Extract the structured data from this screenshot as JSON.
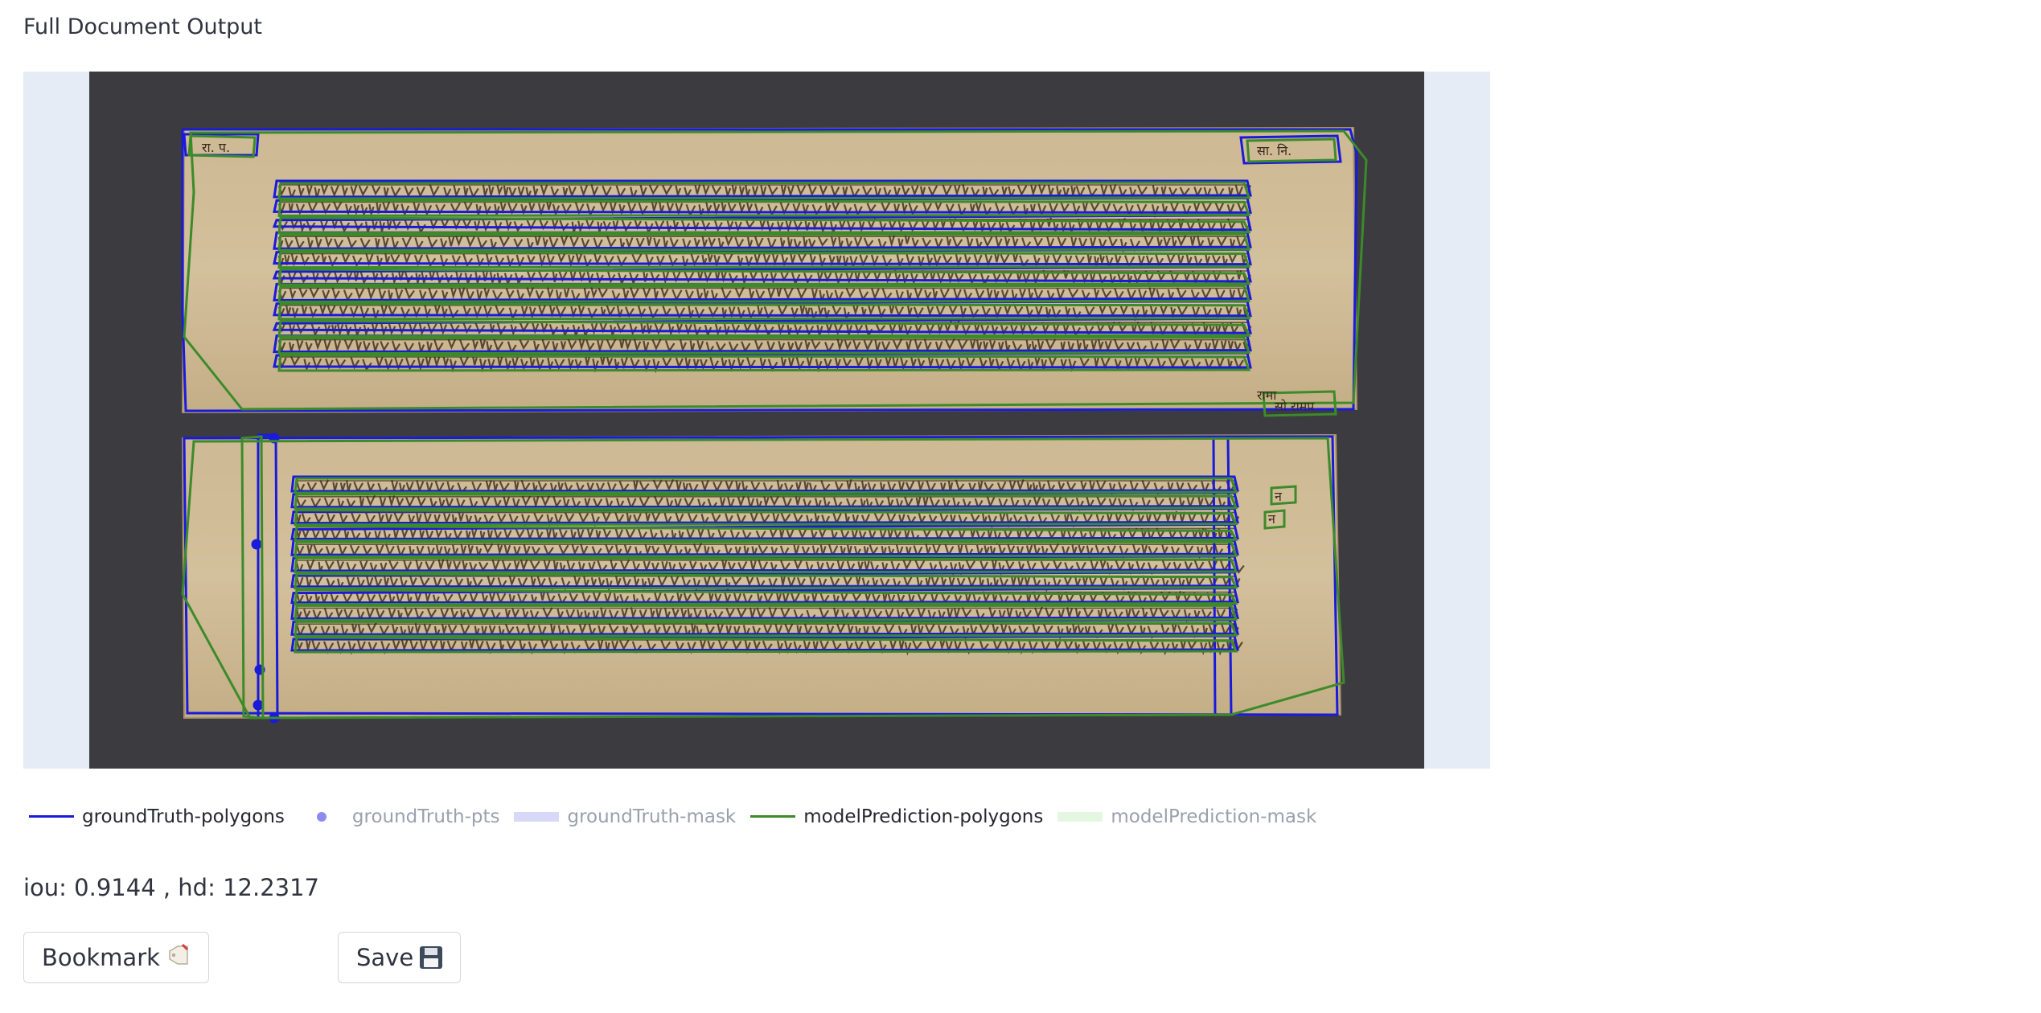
{
  "page": {
    "title": "Full Document Output"
  },
  "legend": [
    {
      "label": "groundTruth-polygons",
      "color": "#1a1adb",
      "kind": "line",
      "visible": true
    },
    {
      "label": "groundTruth-pts",
      "color": "#8c8cf0",
      "kind": "dot",
      "visible": false
    },
    {
      "label": "groundTruth-mask",
      "color": "#d8d8f8",
      "kind": "box",
      "visible": false
    },
    {
      "label": "modelPrediction-polygons",
      "color": "#3d8a2a",
      "kind": "line",
      "visible": true
    },
    {
      "label": "modelPrediction-mask",
      "color": "#e4f7e0",
      "kind": "box",
      "visible": false
    }
  ],
  "metrics": {
    "text": "iou: 0.9144 , hd: 12.2317"
  },
  "buttons": {
    "bookmark": {
      "label": "Bookmark",
      "icon": "bookmark-tag-icon"
    },
    "save": {
      "label": "Save",
      "icon": "floppy-disk-icon"
    }
  },
  "colors": {
    "plot_bg": "#e5ecf6",
    "image_bg": "#3c3b40",
    "palm_leaf": "#c8b48e",
    "ground_truth": "#1a1adb",
    "prediction": "#3d8a2a"
  },
  "document": {
    "margin_labels": [
      "रा. प.",
      "सा. नि.",
      "न",
      "न",
      "सो रामप",
      "रामा"
    ],
    "leaf1_line_count": 11,
    "leaf2_line_count": 11
  }
}
